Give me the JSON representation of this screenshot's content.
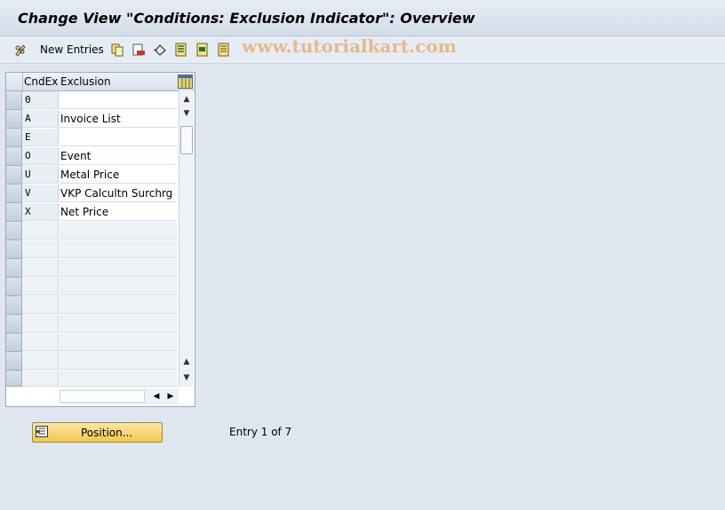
{
  "window": {
    "title": "Change View \"Conditions: Exclusion Indicator\": Overview"
  },
  "toolbar": {
    "new_entries_label": "New Entries"
  },
  "watermark": "www.tutorialkart.com",
  "table": {
    "columns": [
      "CndEx",
      "Exclusion"
    ],
    "rows": [
      {
        "key": "0",
        "value": ""
      },
      {
        "key": "A",
        "value": "Invoice List"
      },
      {
        "key": "E",
        "value": ""
      },
      {
        "key": "O",
        "value": "Event"
      },
      {
        "key": "U",
        "value": "Metal Price"
      },
      {
        "key": "V",
        "value": "VKP Calcultn Surchrg"
      },
      {
        "key": "X",
        "value": "Net Price"
      }
    ]
  },
  "footer": {
    "position_label": "Position...",
    "entry_text": "Entry 1 of 7"
  }
}
